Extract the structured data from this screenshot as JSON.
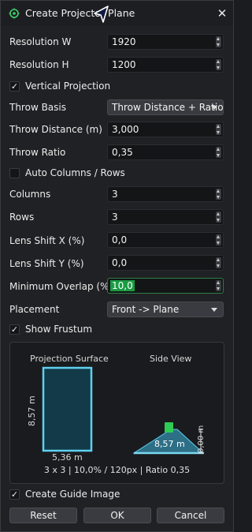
{
  "window": {
    "title": "Create Projector Plane",
    "close_glyph": "✕"
  },
  "fields": {
    "resolution_w": {
      "label": "Resolution W",
      "value": "1920"
    },
    "resolution_h": {
      "label": "Resolution H",
      "value": "1200"
    },
    "vertical_projection": {
      "label": "Vertical Projection",
      "checked": true
    },
    "throw_basis": {
      "label": "Throw Basis",
      "value": "Throw Distance + Ratio"
    },
    "throw_distance": {
      "label": "Throw Distance (m)",
      "value": "3,000"
    },
    "throw_ratio": {
      "label": "Throw Ratio",
      "value": "0,35"
    },
    "auto_columns_rows": {
      "label": "Auto Columns / Rows",
      "checked": false
    },
    "columns": {
      "label": "Columns",
      "value": "3"
    },
    "rows": {
      "label": "Rows",
      "value": "3"
    },
    "lens_shift_x": {
      "label": "Lens Shift X (%)",
      "value": "0,0"
    },
    "lens_shift_y": {
      "label": "Lens Shift Y (%)",
      "value": "0,0"
    },
    "minimum_overlap": {
      "label": "Minimum Overlap (%)",
      "value": "10,0"
    },
    "placement": {
      "label": "Placement",
      "value": "Front -> Plane"
    },
    "show_frustum": {
      "label": "Show Frustum",
      "checked": true
    }
  },
  "preview": {
    "projection_surface_title": "Projection Surface",
    "side_view_title": "Side View",
    "surface_height_label": "8,57 m",
    "surface_width_label": "5,36 m",
    "side_distance_label": "8,57 m",
    "side_height_label": "0,00 m",
    "summary": "3 x 3  |  10,0% / 120px  |  Ratio 0,35"
  },
  "create_guide_image": {
    "label": "Create Guide Image",
    "checked": true
  },
  "buttons": {
    "reset": "Reset",
    "ok": "OK",
    "cancel": "Cancel"
  },
  "colors": {
    "accent_green": "#1a9c43",
    "surface_outline": "#5fd0f0",
    "surface_fill": "#123a48",
    "frustum_fill": "#2d6f86",
    "projector": "#2ecc55"
  },
  "icons": {
    "title_icon": "projector-gear-icon",
    "cursor": "mouse-pointer-icon",
    "close": "close-icon",
    "checkmark": "checkmark-icon",
    "spin_arrows": "spinner-arrows-icon",
    "dropdown": "chevron-down-icon"
  }
}
